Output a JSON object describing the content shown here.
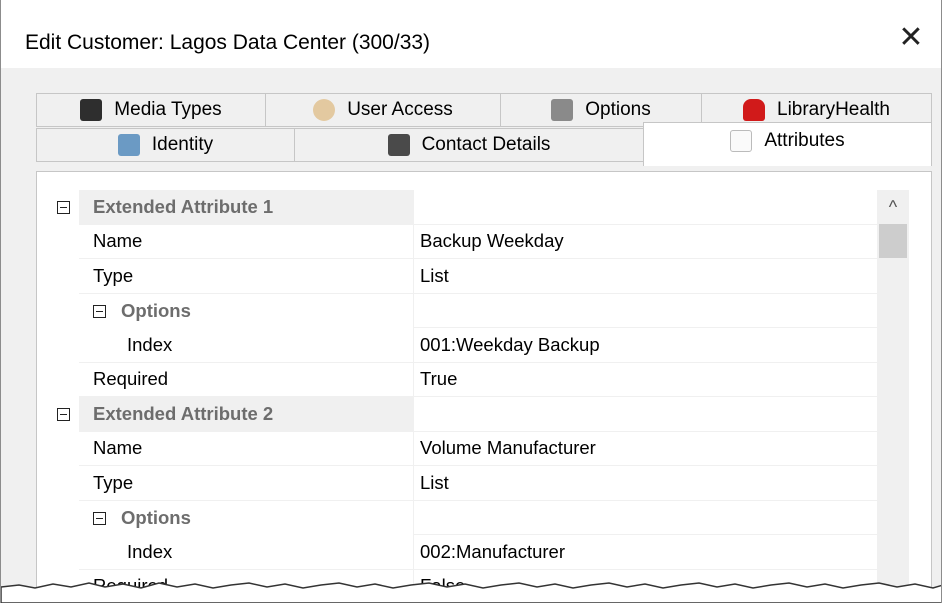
{
  "window": {
    "title": "Edit Customer: Lagos Data Center (300/33)",
    "close_glyph": "✕"
  },
  "tabs_row1": [
    {
      "label": "Media Types",
      "icon": "media-types-icon",
      "color": "#2e2e2e"
    },
    {
      "label": "User Access",
      "icon": "user-access-icon",
      "color": "#e3c9a0"
    },
    {
      "label": "Options",
      "icon": "options-icon",
      "color": "#8a8a8a"
    },
    {
      "label": "LibraryHealth",
      "icon": "library-health-icon",
      "color": "#d11a1a"
    }
  ],
  "tabs_row2": [
    {
      "label": "Identity",
      "icon": "identity-icon",
      "color": "#6b9ac4"
    },
    {
      "label": "Contact Details",
      "icon": "contact-details-icon",
      "color": "#4a4a4a"
    },
    {
      "label": "Attributes",
      "icon": "attributes-icon",
      "color": "#cccccc",
      "active": true
    }
  ],
  "grid": {
    "rows": [
      {
        "kind": "category",
        "label": "Extended Attribute 1",
        "value": ""
      },
      {
        "kind": "prop",
        "label": "Name",
        "value": "Backup Weekday"
      },
      {
        "kind": "prop",
        "label": "Type",
        "value": "List"
      },
      {
        "kind": "subcategory",
        "label": "Options",
        "value": ""
      },
      {
        "kind": "subprop",
        "label": "Index",
        "value": "001:Weekday Backup"
      },
      {
        "kind": "prop",
        "label": "Required",
        "value": "True"
      },
      {
        "kind": "category",
        "label": "Extended Attribute 2",
        "value": ""
      },
      {
        "kind": "prop",
        "label": "Name",
        "value": "Volume Manufacturer"
      },
      {
        "kind": "prop",
        "label": "Type",
        "value": "List"
      },
      {
        "kind": "subcategory",
        "label": "Options",
        "value": ""
      },
      {
        "kind": "subprop",
        "label": "Index",
        "value": "002:Manufacturer"
      },
      {
        "kind": "prop",
        "label": "Required",
        "value": "False"
      }
    ]
  },
  "scrollbar": {
    "up_glyph": "^"
  }
}
